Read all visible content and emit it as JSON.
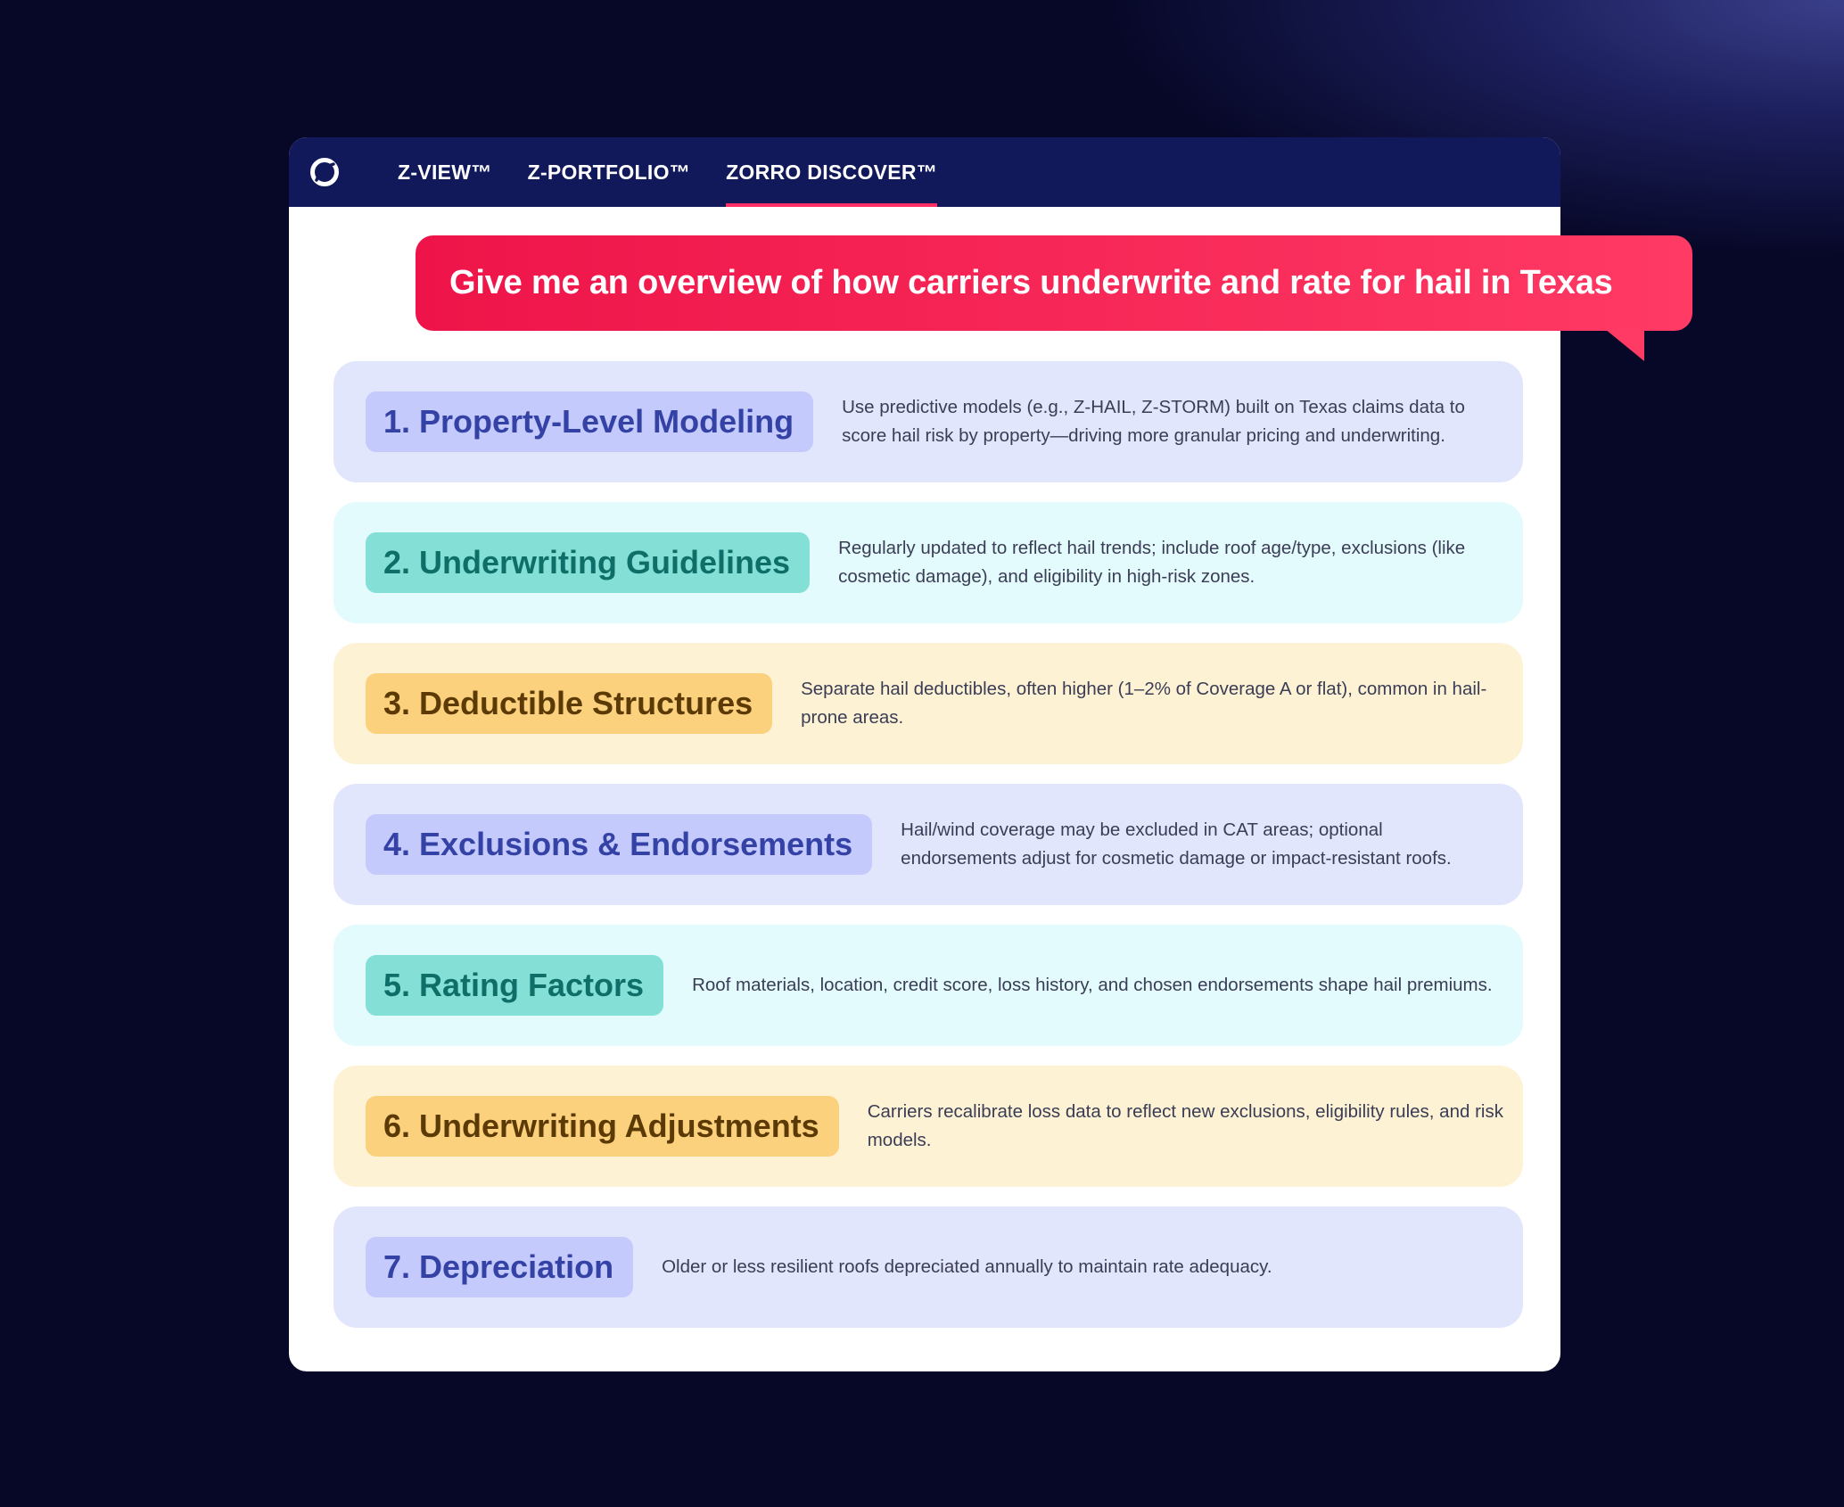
{
  "nav": {
    "tabs": [
      {
        "label": "Z-VIEW™"
      },
      {
        "label": "Z-PORTFOLIO™"
      },
      {
        "label": "ZORRO DISCOVER™"
      }
    ],
    "active_tab": 2
  },
  "prompt": {
    "text": "Give me an overview of how carriers underwrite and rate for hail in Texas"
  },
  "cards": [
    {
      "title": "1. Property-Level Modeling",
      "description": "Use predictive models (e.g., Z-HAIL, Z-STORM) built on Texas claims data to score hail risk by property—driving more granular pricing and underwriting.",
      "theme": "lavender"
    },
    {
      "title": "2. Underwriting Guidelines",
      "description": "Regularly updated to reflect hail trends; include roof age/type, exclusions (like cosmetic damage), and eligibility in high-risk zones.",
      "theme": "cyan"
    },
    {
      "title": "3. Deductible Structures",
      "description": "Separate hail deductibles, often higher (1–2% of Coverage A or flat), common in hail-prone areas.",
      "theme": "amber"
    },
    {
      "title": "4. Exclusions & Endorsements",
      "description": "Hail/wind coverage may be excluded in CAT areas; optional endorsements adjust for cosmetic damage or impact-resistant roofs.",
      "theme": "lavender"
    },
    {
      "title": "5. Rating Factors",
      "description": "Roof materials, location, credit score, loss history, and chosen endorsements shape hail premiums.",
      "theme": "cyan"
    },
    {
      "title": "6. Underwriting Adjustments",
      "description": "Carriers recalibrate loss data to reflect new exclusions, eligibility rules, and risk models.",
      "theme": "amber"
    },
    {
      "title": "7. Depreciation",
      "description": "Older or less resilient roofs depreciated annually to maintain rate adequacy.",
      "theme": "lavender"
    }
  ],
  "colors": {
    "background": "#070828",
    "nav_bg": "#11195a",
    "accent": "#ff2e63",
    "lavender_card": "#e2e6fd",
    "lavender_pill": "#c4cafc",
    "cyan_card": "#e3fbfd",
    "cyan_pill": "#84e0d6",
    "amber_card": "#fef2d5",
    "amber_pill": "#fbd17e"
  },
  "icons": {
    "logo": "zorro-logo-icon"
  }
}
